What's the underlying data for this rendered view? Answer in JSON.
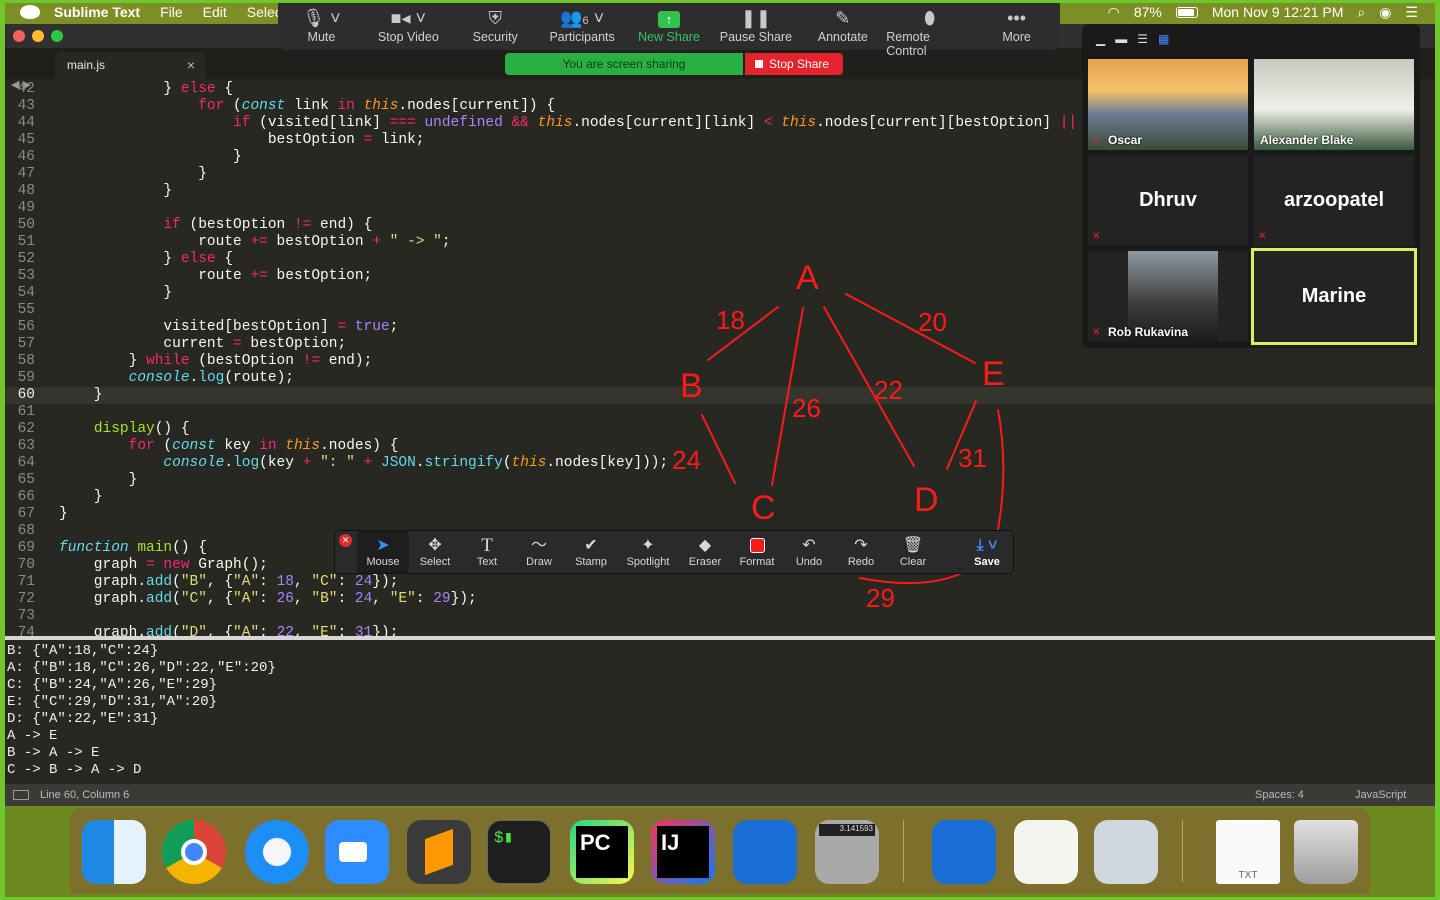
{
  "menubar": {
    "app_name": "Sublime Text",
    "items": [
      "File",
      "Edit",
      "Selec"
    ],
    "battery": "87%",
    "datetime": "Mon Nov 9  12:21 PM"
  },
  "zoom_toolbar": {
    "buttons": [
      {
        "label": "Mute",
        "icon": "microphone-icon"
      },
      {
        "label": "Stop Video",
        "icon": "video-camera-icon"
      },
      {
        "label": "Security",
        "icon": "shield-icon"
      },
      {
        "label": "Participants",
        "icon": "participants-icon",
        "count": "6"
      },
      {
        "label": "New Share",
        "icon": "share-arrow-icon"
      },
      {
        "label": "Pause Share",
        "icon": "pause-icon"
      },
      {
        "label": "Annotate",
        "icon": "pen-icon"
      },
      {
        "label": "Remote Control",
        "icon": "mouse-icon"
      },
      {
        "label": "More",
        "icon": "ellipsis-icon"
      }
    ],
    "sharing_banner": "You are screen sharing",
    "stop_share": "Stop Share"
  },
  "editor": {
    "tab": "main.js",
    "gutter_numbers": [
      "42",
      "43",
      "44",
      "45",
      "46",
      "47",
      "48",
      "49",
      "50",
      "51",
      "52",
      "53",
      "54",
      "55",
      "56",
      "57",
      "58",
      "59",
      "60",
      "61",
      "62",
      "63",
      "64",
      "65",
      "66",
      "67",
      "68",
      "69",
      "70",
      "71",
      "72",
      "73",
      "74"
    ],
    "active_line": "60"
  },
  "console": {
    "lines": [
      "B: {\"A\":18,\"C\":24}",
      "A: {\"B\":18,\"C\":26,\"D\":22,\"E\":20}",
      "C: {\"B\":24,\"A\":26,\"E\":29}",
      "E: {\"C\":29,\"D\":31,\"A\":20}",
      "D: {\"A\":22,\"E\":31}",
      "A -> E",
      "B -> A -> E",
      "C -> B -> A -> D"
    ]
  },
  "statusbar": {
    "position": "Line 60, Column 6",
    "spaces": "Spaces: 4",
    "language": "JavaScript"
  },
  "participants": [
    {
      "name": "Oscar",
      "video": true,
      "muted": true
    },
    {
      "name": "Alexander Blake",
      "video": true,
      "muted": false
    },
    {
      "name": "Dhruv",
      "video": false,
      "muted": true
    },
    {
      "name": "arzoopatel",
      "video": false,
      "muted": true
    },
    {
      "name": "Rob Rukavina",
      "video": true,
      "muted": true
    },
    {
      "name": "Marine",
      "video": false,
      "muted": false,
      "active_speaker": true
    }
  ],
  "annotate_toolbar": {
    "tools": [
      "Mouse",
      "Select",
      "Text",
      "Draw",
      "Stamp",
      "Spotlight",
      "Eraser",
      "Format",
      "Undo",
      "Redo",
      "Clear",
      "Save"
    ],
    "selected": "Mouse"
  },
  "drawing": {
    "nodes": [
      "A",
      "B",
      "C",
      "D",
      "E"
    ],
    "edge_weights": [
      "18",
      "20",
      "26",
      "22",
      "24",
      "31",
      "29"
    ],
    "ink_color": "#ff1a1a"
  },
  "dock": {
    "apps": [
      "finder-icon",
      "chrome-icon",
      "safari-icon",
      "zoom-icon",
      "sublime-icon",
      "terminal-icon",
      "pycharm-icon",
      "intellij-icon",
      "xcode-icon",
      "calculator-icon",
      "xcode-icon",
      "textedit-icon",
      "preview-icon",
      "txt-file-icon",
      "trash-icon"
    ],
    "calculator_display": "3.141593",
    "txt_label": "TXT"
  }
}
